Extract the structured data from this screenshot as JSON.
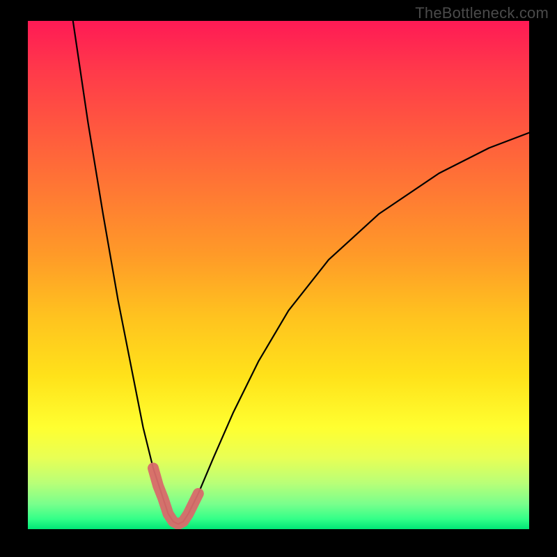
{
  "watermark": "TheBottleneck.com",
  "chart_data": {
    "type": "line",
    "title": "",
    "xlabel": "",
    "ylabel": "",
    "xlim": [
      0,
      100
    ],
    "ylim": [
      0,
      100
    ],
    "series": [
      {
        "name": "bottleneck-curve",
        "x": [
          9.0,
          12.0,
          15.0,
          18.0,
          21.0,
          23.0,
          25.0,
          27.0,
          28.0,
          29.0,
          30.0,
          31.0,
          32.0,
          34.0,
          37.0,
          41.0,
          46.0,
          52.0,
          60.0,
          70.0,
          82.0,
          92.0,
          100.0
        ],
        "y": [
          100.0,
          80.0,
          62.0,
          45.0,
          30.0,
          20.0,
          12.0,
          6.0,
          3.0,
          1.5,
          1.0,
          1.5,
          3.0,
          7.0,
          14.0,
          23.0,
          33.0,
          43.0,
          53.0,
          62.0,
          70.0,
          75.0,
          78.0
        ]
      },
      {
        "name": "highlight-minimum",
        "x": [
          25.0,
          26.0,
          27.0,
          28.0,
          29.0,
          30.0,
          31.0,
          32.0,
          33.0,
          34.0
        ],
        "y": [
          12.0,
          8.5,
          6.0,
          3.0,
          1.5,
          1.0,
          1.5,
          3.0,
          5.0,
          7.0
        ]
      }
    ],
    "colors": {
      "curve": "#000000",
      "highlight": "#d86a6a",
      "background_gradient_top": "#ff1a55",
      "background_gradient_bottom": "#00e676"
    }
  }
}
